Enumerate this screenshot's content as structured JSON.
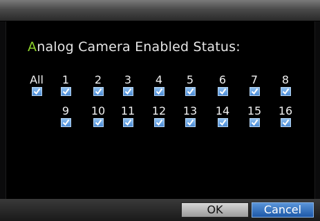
{
  "dialog": {
    "status_title_first": "A",
    "status_title_rest": "nalog Camera Enabled Status:",
    "all_label": "All",
    "all_checked": true,
    "cameras_row1": [
      {
        "label": "1",
        "checked": true
      },
      {
        "label": "2",
        "checked": true
      },
      {
        "label": "3",
        "checked": true
      },
      {
        "label": "4",
        "checked": true
      },
      {
        "label": "5",
        "checked": true
      },
      {
        "label": "6",
        "checked": true
      },
      {
        "label": "7",
        "checked": true
      },
      {
        "label": "8",
        "checked": true
      }
    ],
    "cameras_row2": [
      {
        "label": "9",
        "checked": true
      },
      {
        "label": "10",
        "checked": true
      },
      {
        "label": "11",
        "checked": true
      },
      {
        "label": "12",
        "checked": true
      },
      {
        "label": "13",
        "checked": true
      },
      {
        "label": "14",
        "checked": true
      },
      {
        "label": "15",
        "checked": true
      },
      {
        "label": "16",
        "checked": true
      }
    ]
  },
  "buttons": {
    "ok_label": "OK",
    "cancel_label": "Cancel"
  },
  "colors": {
    "title_accent": "#8ed42c",
    "checkbox_fill": "#4a8bd6",
    "cancel_button": "#1d58a8"
  }
}
